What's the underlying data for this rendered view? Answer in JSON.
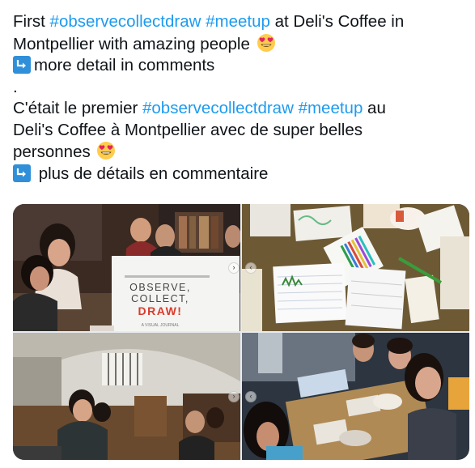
{
  "tweet": {
    "en": {
      "prefix": "First ",
      "hashtag1": "#observecollectdraw",
      "space": " ",
      "hashtag2": "#meetup",
      "suffix1": " at Deli's Coffee in",
      "line2": "Montpellier with amazing people ",
      "line3": "more detail in comments"
    },
    "separator": ".",
    "fr": {
      "prefix": "C'était le premier ",
      "hashtag1": "#observecollectdraw",
      "space": " ",
      "hashtag2": "#meetup",
      "suffix1": " au",
      "line2": "Deli's Coffee à Montpellier avec de super belles",
      "line3": "personnes ",
      "line4": " plus de détails en commentaire"
    }
  },
  "media": {
    "book": {
      "line1": "OBSERVE,",
      "line2": "COLLECT,",
      "line3": "DRAW!",
      "subtitle": "A VISUAL JOURNAL"
    },
    "carousel_prev": "‹",
    "carousel_next": "›"
  },
  "colors": {
    "hashtag": "#1d9bf0",
    "text": "#0f1419",
    "arrow_emoji": "#2f8fd9"
  },
  "icons": [
    "heart-eyes-emoji-icon",
    "arrow-down-right-emoji-icon"
  ]
}
